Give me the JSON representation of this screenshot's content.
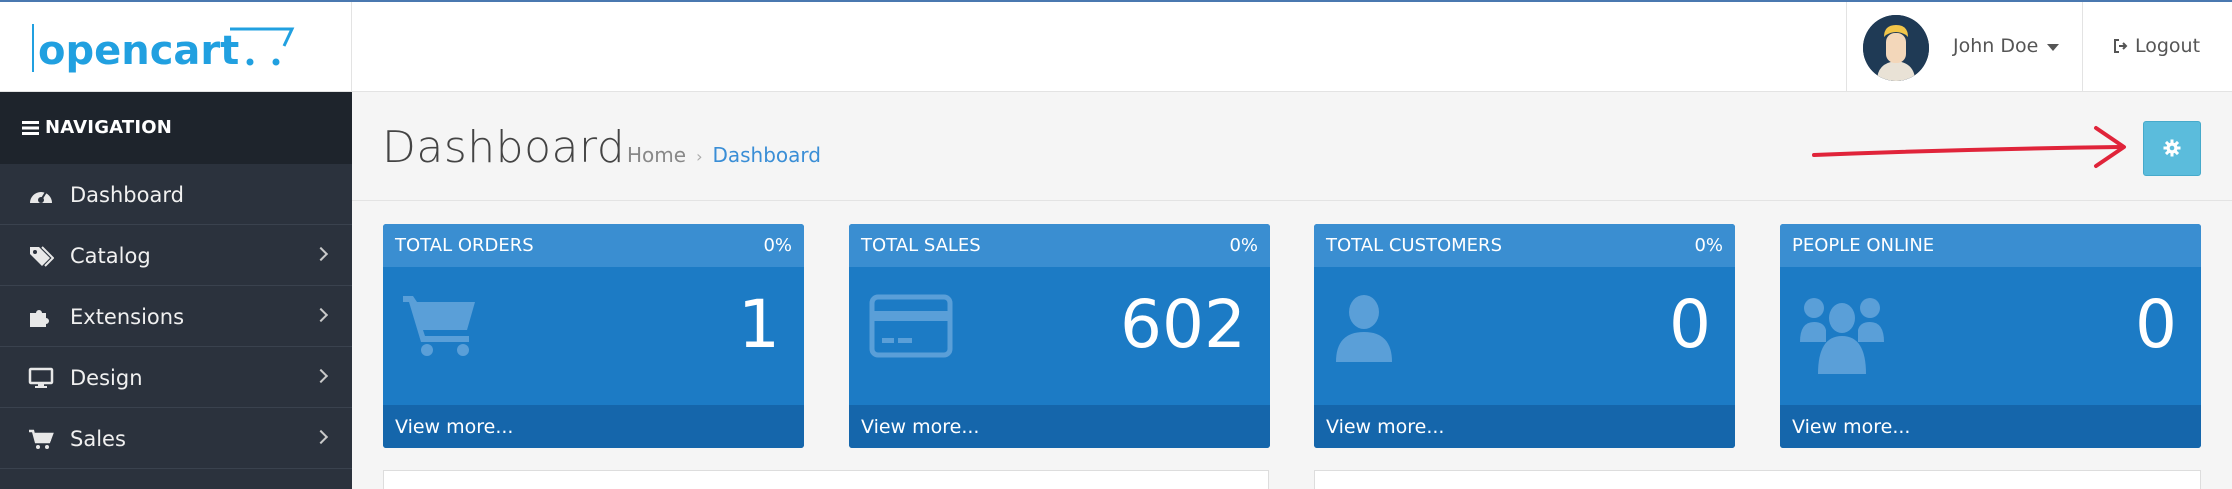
{
  "header": {
    "logo_text": "opencart",
    "user_name": "John Doe",
    "logout_label": "Logout"
  },
  "sidebar": {
    "header_label": "NAVIGATION",
    "items": [
      {
        "label": "Dashboard",
        "icon": "dashboard-icon",
        "has_submenu": false
      },
      {
        "label": "Catalog",
        "icon": "tags-icon",
        "has_submenu": true
      },
      {
        "label": "Extensions",
        "icon": "puzzle-icon",
        "has_submenu": true
      },
      {
        "label": "Design",
        "icon": "desktop-icon",
        "has_submenu": true
      },
      {
        "label": "Sales",
        "icon": "cart-icon",
        "has_submenu": true
      }
    ]
  },
  "page": {
    "title": "Dashboard",
    "breadcrumb": {
      "home": "Home",
      "separator": "›",
      "current": "Dashboard"
    }
  },
  "tiles": [
    {
      "title": "TOTAL ORDERS",
      "percent": "0%",
      "value": "1",
      "icon": "cart-icon",
      "link": "View more..."
    },
    {
      "title": "TOTAL SALES",
      "percent": "0%",
      "value": "602",
      "icon": "credit-card-icon",
      "link": "View more..."
    },
    {
      "title": "TOTAL CUSTOMERS",
      "percent": "0%",
      "value": "0",
      "icon": "user-icon",
      "link": "View more..."
    },
    {
      "title": "PEOPLE ONLINE",
      "percent": "",
      "value": "0",
      "icon": "users-icon",
      "link": "View more..."
    }
  ],
  "colors": {
    "accent": "#1c7bc5",
    "tile_header": "#3a8ed1",
    "tile_footer": "#1566ab",
    "settings_button": "#5bbcdc",
    "sidebar_bg": "#2b323d",
    "annotation_arrow": "#e0243a"
  }
}
